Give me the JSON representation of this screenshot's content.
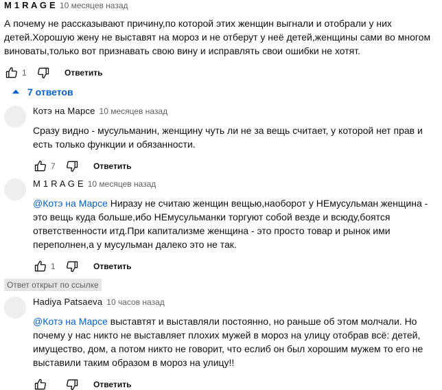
{
  "top_comment": {
    "author": "M 1 R A G E",
    "time": "10 месяцев назад",
    "text": "А почему не рассказывают причину,по которой этих женщин выгнали и отобрали у них детей.Хорошую жену не выставят на мороз и не отберут у неё детей,женщины сами во многом виноваты,только вот признавать свою вину и исправлять свои ошибки не хотят.",
    "likes": "1",
    "reply_label": "Ответить"
  },
  "replies_toggle": {
    "label": "7 ответов"
  },
  "replies": [
    {
      "author": "Котэ на Марсе",
      "time": "10 месяцев назад",
      "mention": "",
      "text": "Сразу видно - мусульманин, женщину чуть ли не за вещь считает, у которой нет прав и есть только функции и обязанности.",
      "likes": "7",
      "reply_label": "Ответить"
    },
    {
      "author": "M 1 R A G E",
      "time": "10 месяцев назад",
      "mention": "@Котэ на Марсе",
      "text": "  Ниразу не считаю женщин вещью,наоборот у НЕмусульман женщина - это вещь куда больше,ибо НЕмусульманки торгуют собой везде и всюду,боятся ответственности итд.При капитализме женщина - это просто товар и рынок ими переполнен,а у мусульман далеко это не так.",
      "likes": "1",
      "reply_label": "Ответить"
    },
    {
      "author": "Hadiya Patsaeva",
      "time": "10 часов назад",
      "mention": "@Котэ на Марсе",
      "text": "  выставтят и выставляли постоянно, но раньше об этом молчали. Но почему у нас никто не выставляет плохих мужей в мороз на улицу отобрав всё: детей, имущество, дом, а потом никто не говорит, что еслиб он был хорошим мужем то его не выставили таким образом в мороз на  улицу!!",
      "likes": "",
      "reply_label": "Ответить"
    }
  ],
  "linked_badge": "Ответ открыт по ссылке",
  "colors": {
    "link": "#065fd4",
    "secondary": "#606060",
    "avatar": "#eeeeee"
  }
}
